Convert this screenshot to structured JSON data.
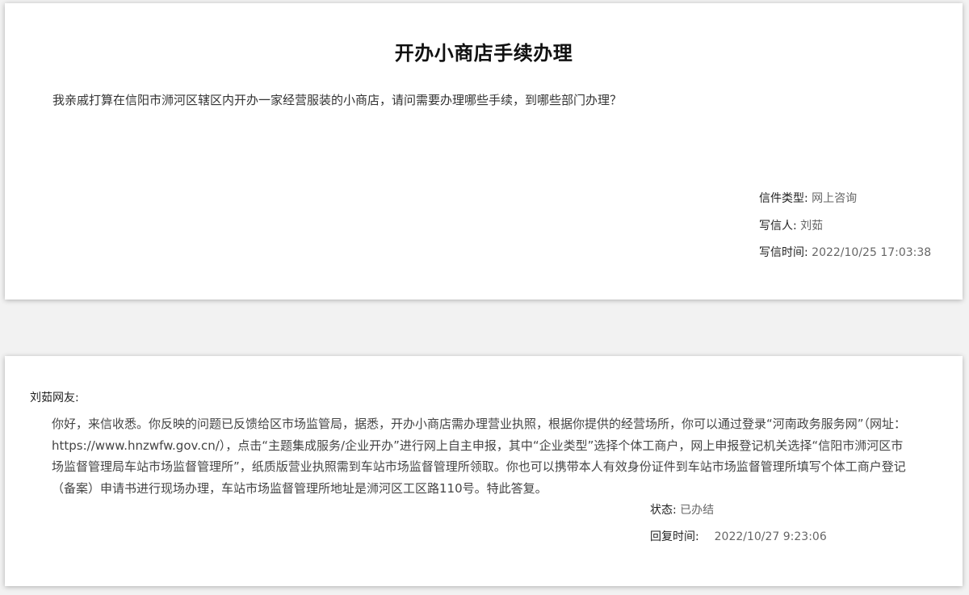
{
  "letter": {
    "title": "开办小商店手续办理",
    "content": "我亲戚打算在信阳市浉河区辖区内开办一家经营服装的小商店，请问需要办理哪些手续，到哪些部门办理？",
    "meta": {
      "type_label": "信件类型:",
      "type_value": "网上咨询",
      "writer_label": "写信人:",
      "writer_value": "刘茹",
      "time_label": "写信时间:",
      "time_value": "2022/10/25 17:03:38"
    }
  },
  "reply": {
    "greeting": "刘茹网友:",
    "content": "你好，来信收悉。你反映的问题已反馈给区市场监管局，据悉，开办小商店需办理营业执照，根据你提供的经营场所，你可以通过登录“河南政务服务网”（网址：https://www.hnzwfw.gov.cn/），点击“主题集成服务/企业开办”进行网上自主申报，其中“企业类型”选择个体工商户，网上申报登记机关选择“信阳市浉河区市场监督管理局车站市场监督管理所”，纸质版营业执照需到车站市场监督管理所领取。你也可以携带本人有效身份证件到车站市场监督管理所填写个体工商户登记（备案）申请书进行现场办理，车站市场监督管理所地址是浉河区工区路110号。特此答复。",
    "meta": {
      "status_label": "状态:",
      "status_value": "已办结",
      "time_label": "回复时间:",
      "time_value": "2022/10/27 9:23:06"
    }
  }
}
